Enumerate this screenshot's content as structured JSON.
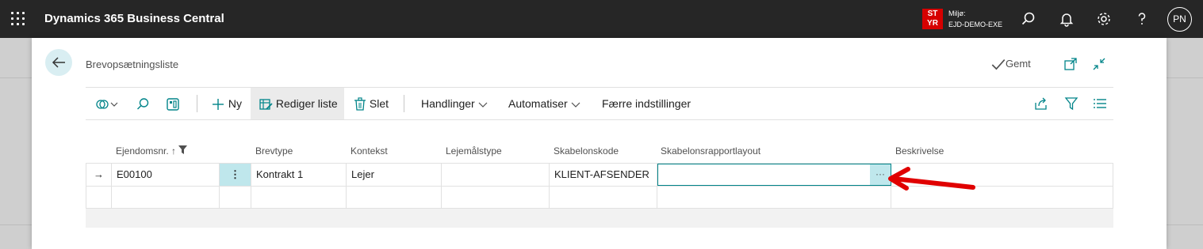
{
  "topbar": {
    "app_title": "Dynamics 365 Business Central",
    "env_badge_line1": "ST",
    "env_badge_line2": "YR",
    "env_label": "Miljø:",
    "env_name": "EJD-DEMO-EXE",
    "user_initials": "PN",
    "icons": [
      "app-launcher-icon",
      "search-icon",
      "bell-icon",
      "gear-icon",
      "help-icon"
    ]
  },
  "page": {
    "title": "Brevopsætningsliste",
    "saved_status": "Gemt"
  },
  "actionbar": {
    "new_label": "Ny",
    "edit_list_label": "Rediger liste",
    "delete_label": "Slet",
    "actions_label": "Handlinger",
    "automate_label": "Automatiser",
    "fewer_options_label": "Færre indstillinger"
  },
  "table": {
    "columns": {
      "property_no": "Ejendomsnr.",
      "letter_type": "Brevtype",
      "context": "Kontekst",
      "lease_type": "Lejemålstype",
      "template_code": "Skabelonskode",
      "template_report_layout": "Skabelonsrapportlayout",
      "description": "Beskrivelse"
    },
    "rows": [
      {
        "property_no": "E00100",
        "letter_type": "Kontrakt 1",
        "context": "Lejer",
        "lease_type": "",
        "template_code": "KLIENT-AFSENDER",
        "template_report_layout": "",
        "description": ""
      }
    ],
    "lookup_button": "···",
    "row_menu_glyph": "⋮",
    "current_row_marker": "→",
    "sort_arrow": "↑"
  },
  "colors": {
    "topbar_bg": "#262626",
    "env_badge": "#d60000",
    "accent_teal": "#008489",
    "selection_bg": "#bfe7ec",
    "annotation_arrow": "#e00000"
  }
}
